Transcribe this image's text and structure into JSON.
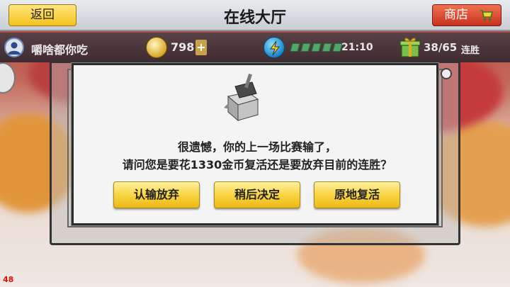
{
  "header": {
    "back_label": "返回",
    "title": "在线大厅",
    "shop_label": "商店",
    "shop_icon": "cart-icon"
  },
  "status": {
    "username": "嚼啥都你吃",
    "coins": "798",
    "coin_plus": "+",
    "energy_segments": 5,
    "timer": "21:10",
    "streak": "38/65",
    "streak_label": "连胜"
  },
  "dialog": {
    "icon": "gift-box-icon",
    "message_line1": "很遗憾，你的上一场比赛输了，",
    "message_line2": "请问您是要花1330金币复活还是要放弃目前的连胜？",
    "buttons": {
      "give_up": "认输放弃",
      "later": "稍后决定",
      "revive": "原地复活"
    }
  },
  "fps": "48",
  "colors": {
    "button_yellow": "#f8d23a",
    "shop_red": "#c8321e",
    "status_bar": "#4a353b"
  }
}
